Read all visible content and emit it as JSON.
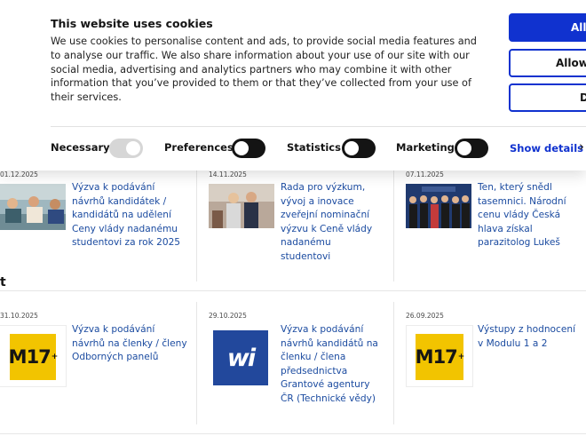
{
  "cookie": {
    "title": "This website uses cookies",
    "body": "We use cookies to personalise content and ads, to provide social media features and to analyse our traffic. We also share information about your use of our site with our social media, advertising and analytics partners who may combine it with other information that you’ve provided to them or that they’ve collected from your use of their services.",
    "buttons": {
      "allow_all": "Allow all",
      "allow_selection": "Allow selection",
      "deny": "Deny"
    },
    "toggles": [
      {
        "label": "Necessary",
        "state": "on-disabled"
      },
      {
        "label": "Preferences",
        "state": "off"
      },
      {
        "label": "Statistics",
        "state": "off"
      },
      {
        "label": "Marketing",
        "state": "off"
      }
    ],
    "show_details": "Show details",
    "accent_color": "#1032cf"
  },
  "news": [
    {
      "date": "01.12.2025",
      "title": "Výzva k podávání návrhů kandidátek / kandidátů na udělení Ceny vlády nadanému studentovi za rok 2025",
      "thumb": "photo-students"
    },
    {
      "date": "14.11.2025",
      "title": "Rada pro výzkum, vývoj a inovace zveřejní nominační výzvu k Ceně vlády nadanému studentovi",
      "thumb": "photo-handshake"
    },
    {
      "date": "07.11.2025",
      "title": "Ten, který snědl tasemnici. Národní cenu vlády Česká hlava získal parazitolog Lukeš",
      "thumb": "photo-group"
    },
    {
      "date": "31.10.2025",
      "title": "Výzva k podávání návrhů na členky / členy Odborných panelů",
      "thumb": "m17-logo"
    },
    {
      "date": "29.10.2025",
      "title": "Výzva k podávání návrhů kandidátů na členku / člena předsednictva Grantové agentury ČR (Technické vědy)",
      "thumb": "vvi-logo"
    },
    {
      "date": "26.09.2025",
      "title": "Výstupy z hodnocení v Modulu 1 a 2",
      "thumb": "m17-logo"
    }
  ],
  "logos": {
    "m17": "M17",
    "m17_plus": "+",
    "wi": "wi"
  },
  "brand_stub": "t"
}
